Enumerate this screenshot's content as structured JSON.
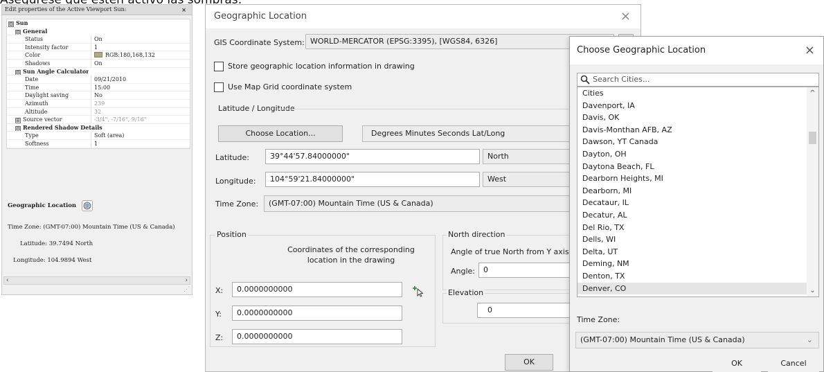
{
  "heading_fragment": "Asegúrese que estén activo las sombras:",
  "palette": {
    "title": "Edit properties of the Active Viewport Sun:",
    "close": "×",
    "rows": [
      {
        "type": "section",
        "level": 0,
        "expander": "⊟",
        "label": "Sun"
      },
      {
        "type": "section",
        "level": 1,
        "expander": "⊟",
        "label": "General"
      },
      {
        "type": "prop",
        "label": "Status",
        "value": "On"
      },
      {
        "type": "prop",
        "label": "Intensity factor",
        "value": "1"
      },
      {
        "type": "prop",
        "label": "Color",
        "value": "RGB:180,168,132",
        "swatch": "#b4a884"
      },
      {
        "type": "prop",
        "label": "Shadows",
        "value": "On"
      },
      {
        "type": "section",
        "level": 1,
        "expander": "⊟",
        "label": "Sun Angle Calculator"
      },
      {
        "type": "prop",
        "label": "Date",
        "value": "09/21/2010"
      },
      {
        "type": "prop",
        "label": "Time",
        "value": "15:00"
      },
      {
        "type": "prop",
        "label": "Daylight saving",
        "value": "No"
      },
      {
        "type": "prop",
        "label": "Azimuth",
        "value": "239",
        "grey": true
      },
      {
        "type": "prop",
        "label": "Altitude",
        "value": "32",
        "grey": true
      },
      {
        "type": "prop",
        "label": "Source vector",
        "value": "-3/4\", -7/16\", 9/16\"",
        "grey": true,
        "expander": "⊞"
      },
      {
        "type": "section",
        "level": 1,
        "expander": "⊟",
        "label": "Rendered Shadow Details"
      },
      {
        "type": "prop",
        "label": "Type",
        "value": "Soft (area)"
      },
      {
        "type": "prop",
        "label": "Softness",
        "value": "1"
      }
    ],
    "geo_title": "Geographic Location",
    "time_zone_line": "Time Zone:   (GMT-07:00) Mountain Time (US & Canada)",
    "latitude_line": "Latitude:  39.7494 North",
    "longitude_line": "Longitude:  104.9894 West",
    "scroll_left": "‹",
    "scroll_right": "›"
  },
  "geo_dialog": {
    "title": "Geographic Location",
    "close": "×",
    "gis_label": "GIS Coordinate System:",
    "gis_value": "WORLD-MERCATOR (EPSG:3395), [WGS84, 6326]",
    "store_label": "Store geographic location information in drawing",
    "map_grid_label": "Use Map Grid coordinate system",
    "latlong_group": "Latitude / Longitude",
    "choose_location_btn": "Choose Location...",
    "format_value": "Degrees Minutes Seconds Lat/Long",
    "latitude_label": "Latitude:",
    "latitude_value": "39°44'57.84000000\"",
    "latitude_dir": "North",
    "longitude_label": "Longitude:",
    "longitude_value": "104°59'21.84000000\"",
    "longitude_dir": "West",
    "timezone_label": "Time Zone:",
    "timezone_value": "(GMT-07:00) Mountain Time (US & Canada)",
    "position_group": "Position",
    "position_desc": "Coordinates of the corresponding location in the drawing",
    "x_label": "X:",
    "x_value": "0.0000000000",
    "y_label": "Y:",
    "y_value": "0.0000000000",
    "z_label": "Z:",
    "z_value": "0.0000000000",
    "north_group": "North direction",
    "north_desc": "Angle of true North from Y axis (CC",
    "angle_label": "Angle:",
    "angle_value": "0",
    "elevation_group": "Elevation",
    "elevation_value": "0",
    "ok_btn": "OK"
  },
  "choose_dialog": {
    "title": "Choose Geographic Location",
    "close": "×",
    "search_placeholder": "Search Cities...",
    "cities": [
      "Cities",
      "Davenport, IA",
      "Davis, OK",
      "Davis-Monthan AFB, AZ",
      "Dawson, YT Canada",
      "Dayton, OH",
      "Daytona Beach, FL",
      "Dearborn Heights, MI",
      "Dearborn, MI",
      "Decataur, IL",
      "Decatur, AL",
      "Del Rio, TX",
      "Dells, WI",
      "Delta, UT",
      "Deming, NM",
      "Denton, TX",
      "Denver, CO"
    ],
    "selected_city": "Denver, CO",
    "timezone_label": "Time Zone:",
    "timezone_value": "(GMT-07:00) Mountain Time (US & Canada)",
    "ok_btn": "OK",
    "cancel_btn": "Cancel"
  }
}
